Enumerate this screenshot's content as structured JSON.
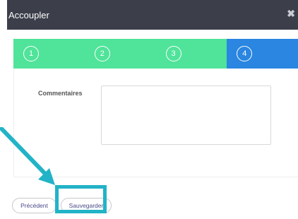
{
  "dialog": {
    "title": "Accoupler",
    "close_icon": "close-icon",
    "colors": {
      "header_bg": "#3c3f4a",
      "step_done": "#50e39a",
      "step_active": "#2a86e0",
      "highlight": "#22b3c7"
    }
  },
  "stepper": {
    "steps": [
      {
        "number": "1",
        "state": "inactive"
      },
      {
        "number": "2",
        "state": "inactive"
      },
      {
        "number": "3",
        "state": "inactive"
      },
      {
        "number": "4",
        "state": "active"
      }
    ]
  },
  "form": {
    "commentaires_label": "Commentaires",
    "commentaires_value": ""
  },
  "buttons": {
    "previous_label": "Précédent",
    "save_label": "Sauvegarder"
  },
  "annotation": {
    "arrow_icon": "arrow-icon",
    "highlight_target": "save-button"
  }
}
